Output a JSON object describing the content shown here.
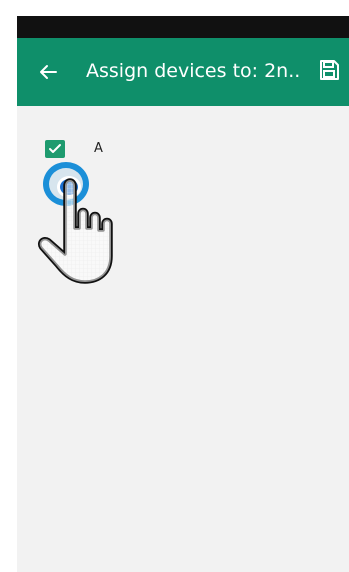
{
  "app_bar": {
    "title": "Assign devices to: 2n...",
    "back_icon": "arrow-left-icon",
    "save_icon": "save-icon",
    "color": "#0f8f6a"
  },
  "devices": [
    {
      "label": "A",
      "checked": true
    }
  ],
  "overlay": {
    "icon": "pointing-hand-icon",
    "tap_color": "#1b8fd8"
  }
}
